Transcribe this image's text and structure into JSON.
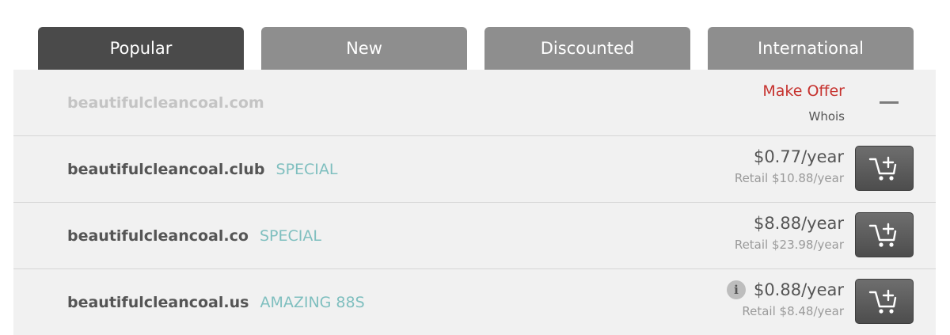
{
  "tabs": [
    {
      "label": "Popular",
      "active": true
    },
    {
      "label": "New",
      "active": false
    },
    {
      "label": "Discounted",
      "active": false
    },
    {
      "label": "International",
      "active": false
    }
  ],
  "results": [
    {
      "domain": "beautifulcleancoal.com",
      "status": "taken",
      "make_offer": "Make Offer",
      "whois": "Whois",
      "collapse_icon": "minus-icon"
    },
    {
      "domain": "beautifulcleancoal.club",
      "tag": "SPECIAL",
      "price": "$0.77/year",
      "retail": "Retail $10.88/year",
      "cart_icon": "add-to-cart-icon"
    },
    {
      "domain": "beautifulcleancoal.co",
      "tag": "SPECIAL",
      "price": "$8.88/year",
      "retail": "Retail $23.98/year",
      "cart_icon": "add-to-cart-icon"
    },
    {
      "domain": "beautifulcleancoal.us",
      "tag": "AMAZING 88S",
      "info_icon": "i",
      "price": "$0.88/year",
      "retail": "Retail $8.48/year",
      "cart_icon": "add-to-cart-icon"
    }
  ],
  "colors": {
    "tab_active": "#4a4a4a",
    "tab_inactive": "#8e8e8e",
    "make_offer": "#c6322e",
    "tag": "#7fbfbf",
    "row_background": "#f1f1f1"
  }
}
